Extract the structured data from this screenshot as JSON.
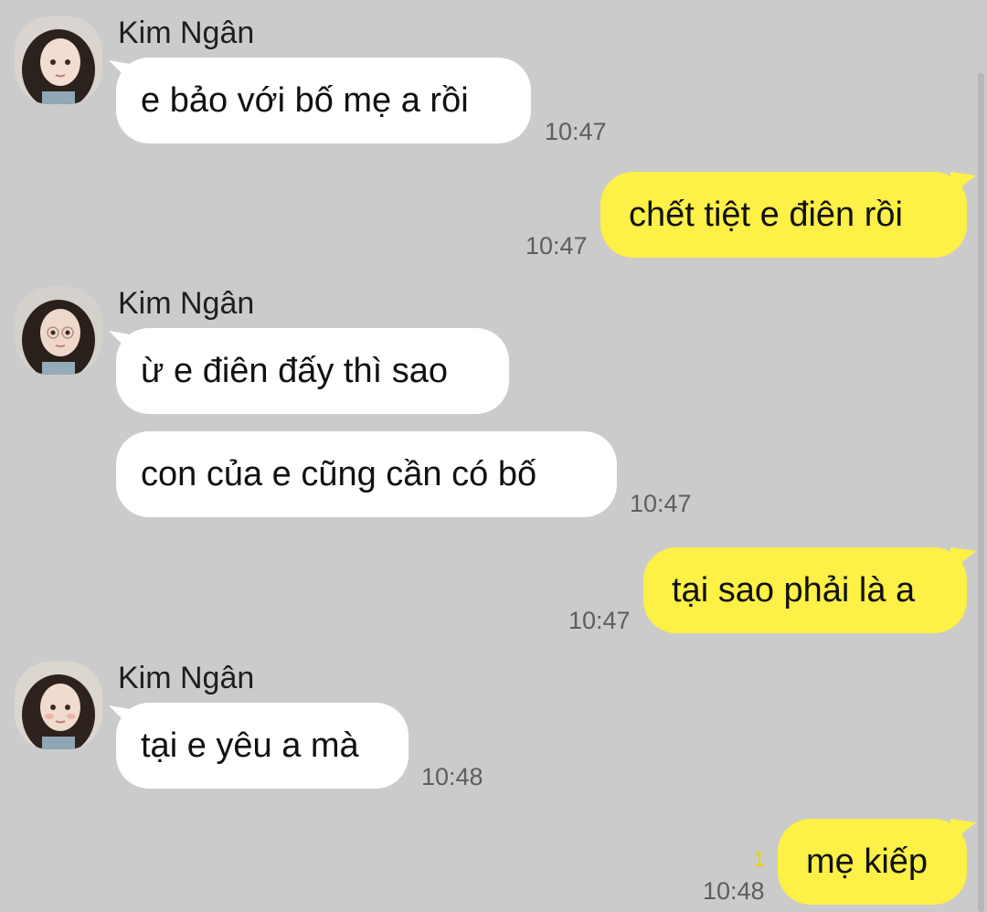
{
  "conversation": {
    "contact_name": "Kim Ngân",
    "colors": {
      "background": "#cbcbcb",
      "incoming_bubble": "#ffffff",
      "outgoing_bubble": "#fdf046",
      "timestamp": "#5e5e5e",
      "unread_indicator": "#e8d400"
    },
    "messages": [
      {
        "direction": "incoming",
        "sender": "Kim Ngân",
        "text": "e bảo với bố mẹ a rồi",
        "time": "10:47",
        "avatar_icon": "profile-photo"
      },
      {
        "direction": "outgoing",
        "text": "chết tiệt e điên rồi",
        "time": "10:47"
      },
      {
        "direction": "incoming",
        "sender": "Kim Ngân",
        "text": "ừ e điên đấy thì sao",
        "avatar_icon": "profile-photo"
      },
      {
        "direction": "incoming",
        "text": "con của e cũng cần có bố",
        "time": "10:47"
      },
      {
        "direction": "outgoing",
        "text": "tại sao phải là a",
        "time": "10:47"
      },
      {
        "direction": "incoming",
        "sender": "Kim Ngân",
        "text": "tại e yêu a mà",
        "time": "10:48",
        "avatar_icon": "profile-photo"
      },
      {
        "direction": "outgoing",
        "text": "mẹ kiếp",
        "time": "10:48",
        "unread_count": "1"
      }
    ]
  }
}
